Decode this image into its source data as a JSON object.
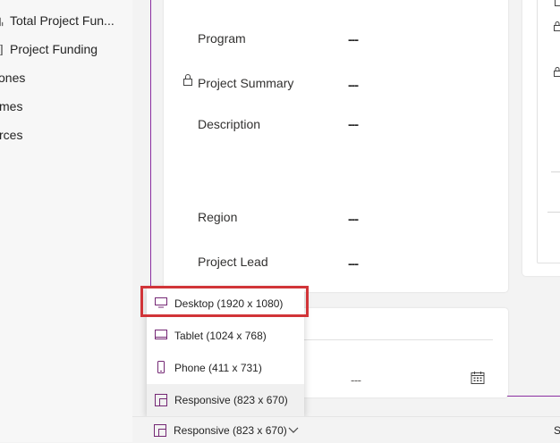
{
  "sidebar": {
    "items": [
      {
        "label": "Total Project Fun..."
      },
      {
        "label": "Project Funding"
      },
      {
        "label": "ones"
      },
      {
        "label": "mes"
      },
      {
        "label": "rces"
      }
    ]
  },
  "form": {
    "fields": [
      {
        "label": "Program",
        "value": "---"
      },
      {
        "label": "Project Summary",
        "value": "---"
      },
      {
        "label": "Description",
        "value": "---"
      },
      {
        "label": "Region",
        "value": "---"
      },
      {
        "label": "Project Lead",
        "value": "---"
      }
    ],
    "lower_value": "---"
  },
  "screen_size_menu": {
    "options": [
      {
        "label": "Desktop (1920 x 1080)",
        "icon": "monitor-icon"
      },
      {
        "label": "Tablet (1024 x 768)",
        "icon": "tablet-icon"
      },
      {
        "label": "Phone (411 x 731)",
        "icon": "phone-icon"
      },
      {
        "label": "Responsive (823 x 670)",
        "icon": "responsive-icon"
      }
    ]
  },
  "statusbar": {
    "selected_size": "Responsive (823 x 670)",
    "right_text": "S"
  },
  "colors": {
    "accent": "#742774",
    "highlight": "#d13438"
  }
}
